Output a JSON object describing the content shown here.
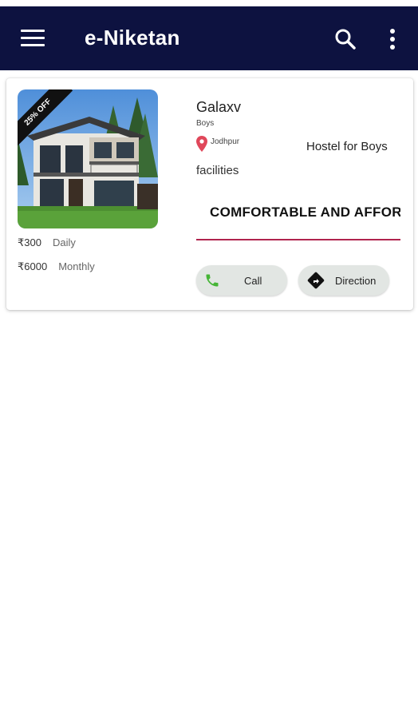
{
  "app": {
    "title": "e-Niketan",
    "header_color": "#0d1240"
  },
  "toolbar": {
    "menu_icon": "hamburger-menu-icon",
    "search_icon": "search-icon",
    "more_icon": "more-vertical-icon"
  },
  "listing": {
    "discount_badge": "25% OFF",
    "name": "Galaxv",
    "gender": "Boys",
    "location": "Jodhpur",
    "type": "Hostel for Boys",
    "facilities_label": "facilities",
    "tagline": "COMFORTABLE AND AFFORDABLE",
    "divider_color": "#b0244e",
    "prices": [
      {
        "amount": "₹300",
        "period": "Daily"
      },
      {
        "amount": "₹6000",
        "period": "Monthly"
      }
    ],
    "actions": {
      "call_label": "Call",
      "direction_label": "Direction"
    }
  }
}
